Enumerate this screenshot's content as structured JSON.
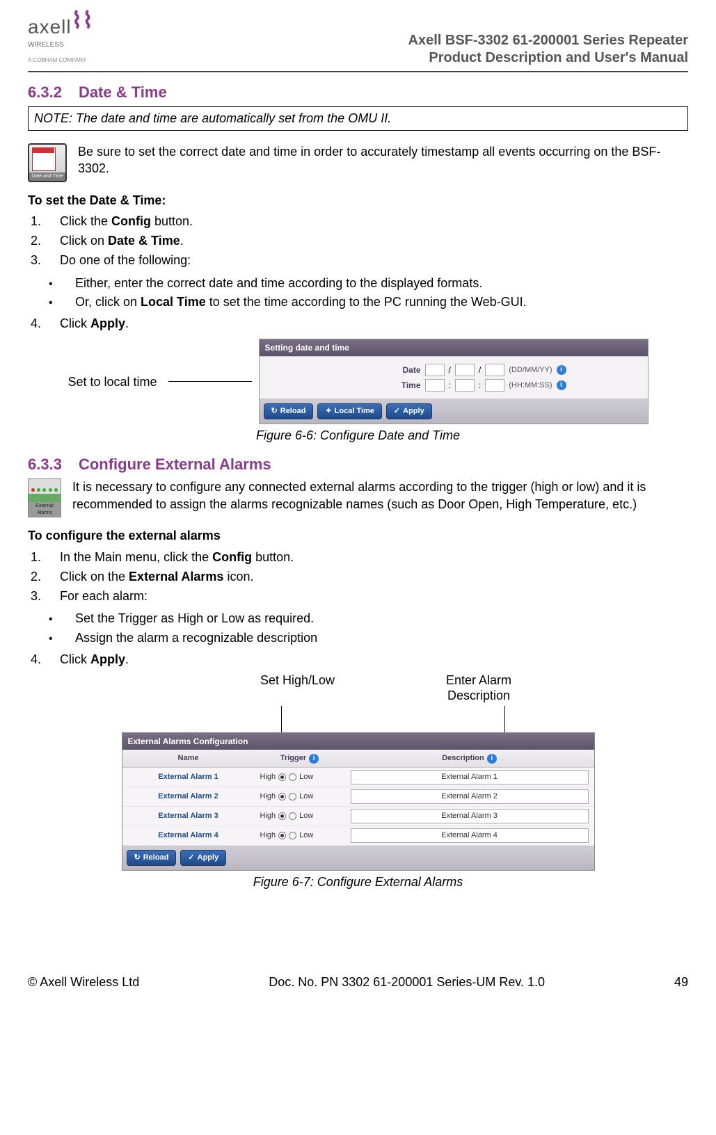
{
  "header": {
    "logo_text": "axell",
    "logo_subtitle": "WIRELESS",
    "logo_company": "A COBHAM COMPANY",
    "doc_title_line1": "Axell BSF-3302 61-200001 Series Repeater",
    "doc_title_line2": "Product Description and User's Manual"
  },
  "section1": {
    "num": "6.3.2",
    "title": "Date & Time",
    "note": "NOTE: The date and time are automatically set from the OMU II.",
    "icon_label": "Date and Time",
    "intro": "Be sure to set the correct date and time in order to accurately timestamp all events occurring on the BSF-3302.",
    "procedure_title": "To set the Date & Time:",
    "steps": {
      "s1_pre": "Click the ",
      "s1_bold": "Config",
      "s1_post": " button.",
      "s2_pre": "Click on ",
      "s2_bold": "Date & Time",
      "s2_post": ".",
      "s3": "Do one of the following:",
      "b1": "Either, enter the correct date and time according to the displayed formats.",
      "b2_pre": "Or, click on ",
      "b2_bold": "Local Time",
      "b2_post": " to set the time according to the PC running the Web-GUI.",
      "s4_pre": "Click ",
      "s4_bold": "Apply",
      "s4_post": "."
    },
    "callout": "Set to local time",
    "dialog": {
      "title": "Setting date and time",
      "date_label": "Date",
      "date_hint": "(DD/MM/YY)",
      "time_label": "Time",
      "time_hint": "(HH:MM:SS)",
      "btn_reload": "Reload",
      "btn_local": "Local Time",
      "btn_apply": "Apply"
    },
    "figure": "Figure 6-6:  Configure Date and Time"
  },
  "section2": {
    "num": "6.3.3",
    "title": "Configure External Alarms",
    "icon_label": "External Alarms",
    "intro": "It is necessary to configure any connected external alarms according to the trigger (high or low) and it is recommended to assign the alarms recognizable names (such as Door Open, High Temperature, etc.)",
    "procedure_title": "To configure the external alarms",
    "steps": {
      "s1_pre": "In the Main menu, click the ",
      "s1_bold": "Config",
      "s1_post": " button.",
      "s2_pre": "Click on the ",
      "s2_bold": "External Alarms",
      "s2_post": " icon.",
      "s3": "For each alarm:",
      "b1": "Set the Trigger as High or Low as required.",
      "b2": "Assign the alarm a recognizable description",
      "s4_pre": "Click ",
      "s4_bold": "Apply",
      "s4_post": "."
    },
    "callout_left": "Set High/Low",
    "callout_right_l1": "Enter Alarm",
    "callout_right_l2": "Description",
    "dialog": {
      "title": "External Alarms Configuration",
      "col_name": "Name",
      "col_trigger": "Trigger",
      "col_desc": "Description",
      "high": "High",
      "low": "Low",
      "rows": [
        {
          "name": "External Alarm 1",
          "desc": "External Alarm 1"
        },
        {
          "name": "External Alarm 2",
          "desc": "External Alarm 2"
        },
        {
          "name": "External Alarm 3",
          "desc": "External Alarm 3"
        },
        {
          "name": "External Alarm 4",
          "desc": "External Alarm 4"
        }
      ],
      "btn_reload": "Reload",
      "btn_apply": "Apply"
    },
    "figure": "Figure 6-7:  Configure External Alarms"
  },
  "footer": {
    "copyright": "© Axell Wireless Ltd",
    "docnum": "Doc. No. PN 3302 61-200001 Series-UM Rev. 1.0",
    "page": "49"
  }
}
